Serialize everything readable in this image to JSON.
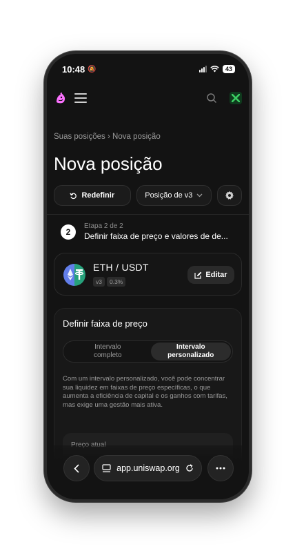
{
  "status": {
    "time": "10:48",
    "battery": "43"
  },
  "breadcrumb": {
    "parent": "Suas posições",
    "separator": "›",
    "current": "Nova posição"
  },
  "page": {
    "title": "Nova posição"
  },
  "actions": {
    "reset_label": "Redefinir",
    "version_label": "Posição de v3"
  },
  "step": {
    "number": "2",
    "label": "Etapa 2 de 2",
    "title": "Definir faixa de preço e valores de de..."
  },
  "pair": {
    "name": "ETH / USDT",
    "version": "v3",
    "fee": "0.3%",
    "edit_label": "Editar"
  },
  "range": {
    "title": "Definir faixa de preço",
    "options": [
      "Intervalo completo",
      "Intervalo personalizado"
    ],
    "selected": "Intervalo personalizado",
    "description": "Com um intervalo personalizado, você pode concentrar sua liquidez em faixas de preço específicas, o que aumenta a eficiência de capital e os ganhos com tarifas, mas exige uma gestão mais ativa.",
    "current_price_label": "Preço atual"
  },
  "browser": {
    "url": "app.uniswap.org"
  },
  "colors": {
    "background": "#131313",
    "accent": "#fc72ff",
    "avatar": "#3ccf63"
  }
}
